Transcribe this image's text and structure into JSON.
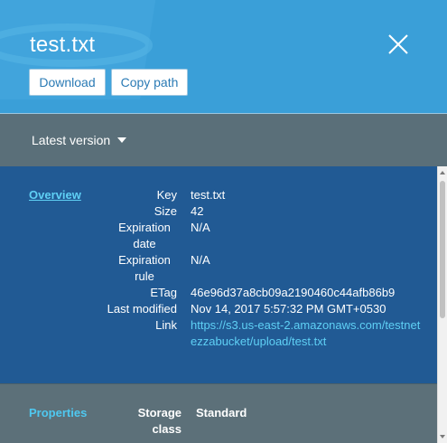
{
  "header": {
    "title": "test.txt",
    "download_label": "Download",
    "copy_path_label": "Copy path"
  },
  "version": {
    "selected": "Latest version"
  },
  "overview": {
    "section_label": "Overview",
    "fields": [
      {
        "label": "Key",
        "value": "test.txt"
      },
      {
        "label": "Size",
        "value": "42"
      },
      {
        "label": "Expiration date",
        "value": "N/A"
      },
      {
        "label": "Expiration rule",
        "value": "N/A"
      },
      {
        "label": "ETag",
        "value": "46e96d37a8cb09a2190460c44afb86b9"
      },
      {
        "label": "Last modified",
        "value": "Nov 14, 2017 5:57:32 PM GMT+0530"
      },
      {
        "label": "Link",
        "value": "https://s3.us-east-2.amazonaws.com/testnetezzabucket/upload/test.txt"
      }
    ]
  },
  "properties": {
    "section_label": "Properties",
    "storage_class_label": "Storage class",
    "storage_class_value": "Standard"
  },
  "colors": {
    "header_bg": "#3a9fd8",
    "version_bar_bg": "#5a6f79",
    "overview_bg": "#215a94",
    "link": "#5fd0f5"
  },
  "icons": [
    "close-icon",
    "caret-down-icon",
    "bucket-art"
  ]
}
